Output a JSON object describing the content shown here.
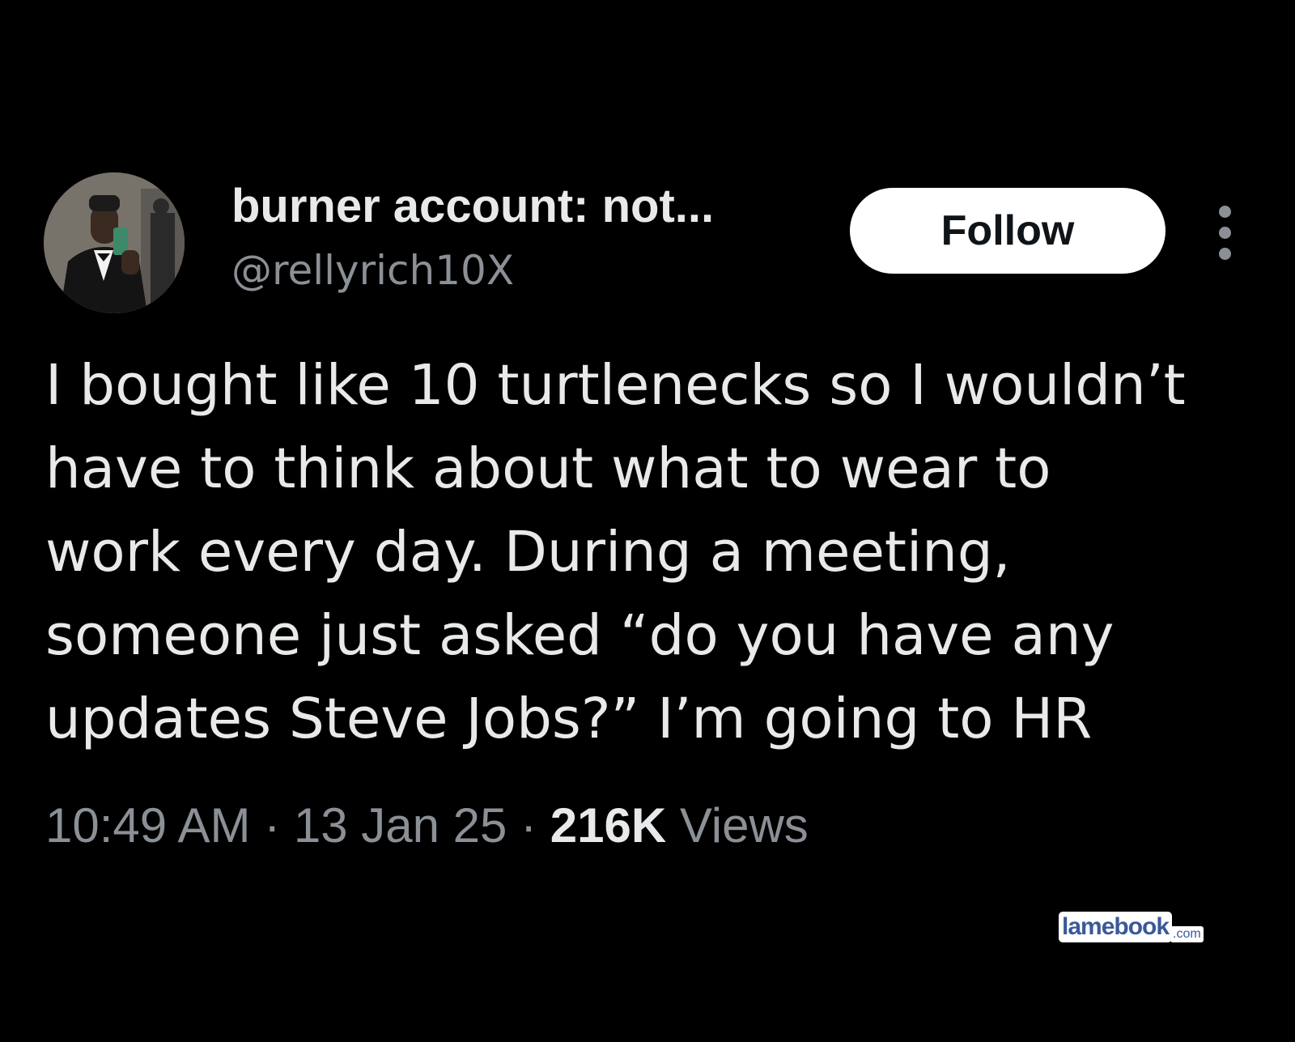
{
  "tweet": {
    "author": {
      "display_name": "burner account: not...",
      "handle": "@rellyrich10X",
      "avatar": "avatar-photo"
    },
    "follow_label": "Follow",
    "more_icon": "more-vertical-icon",
    "text_lines": [
      "I bought like 10 turtlenecks so I wouldn’t",
      "have to think about what to wear to",
      "work every day. During a meeting,",
      "someone just asked “do you have any",
      "updates Steve Jobs?” I’m going to HR"
    ],
    "time": "10:49 AM",
    "date": "13 Jan 25",
    "separator": "·",
    "views_count": "216K",
    "views_label": "Views"
  },
  "watermark": {
    "name": "lamebook",
    "tld": ".com"
  },
  "colors": {
    "background": "#000000",
    "primary_text": "#e7e9ea",
    "secondary_text": "#8b9096",
    "follow_bg": "#ffffff",
    "follow_text": "#0f1419",
    "watermark_blue": "#3b5998"
  }
}
